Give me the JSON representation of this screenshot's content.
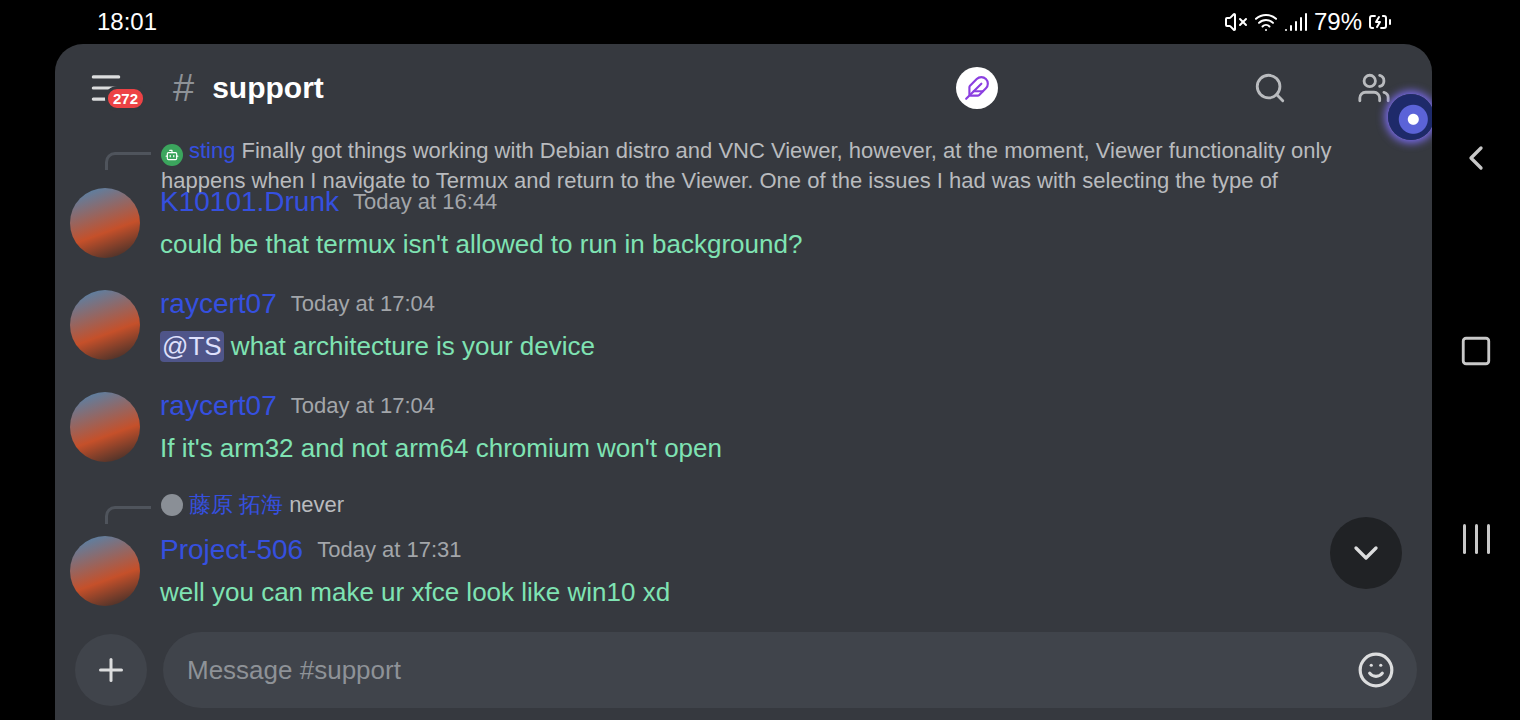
{
  "status_bar": {
    "time": "18:01",
    "battery": "79%"
  },
  "header": {
    "menu_badge": "272",
    "hash": "#",
    "channel": "support"
  },
  "messages": [
    {
      "author": "K10101.Drunk",
      "timestamp": "Today at 16:44",
      "reply": {
        "author": "sting",
        "text": "Finally got things working with Debian distro and VNC Viewer, however, at the moment, Viewer functionality only happens when I navigate to Termux and return to the Viewer.  One of the issues I had was with selecting the type of"
      },
      "parts": [
        {
          "text": "could be that termux isn't allowed to run in background?",
          "mention": false
        }
      ]
    },
    {
      "author": "raycert07",
      "timestamp": "Today at 17:04",
      "reply": null,
      "parts": [
        {
          "text": "@TS",
          "mention": true
        },
        {
          "text": " what architecture is your device",
          "mention": false
        }
      ]
    },
    {
      "author": "raycert07",
      "timestamp": "Today at 17:04",
      "reply": null,
      "parts": [
        {
          "text": "If it's arm32 and not arm64 chromium won't open",
          "mention": false
        }
      ]
    },
    {
      "author": "Project-506",
      "timestamp": "Today at 17:31",
      "reply": {
        "author": "藤原 拓海",
        "text": "never"
      },
      "parts": [
        {
          "text": "well you can make ur xfce look like win10 xd",
          "mention": false
        }
      ]
    }
  ],
  "composer": {
    "placeholder": "Message #support"
  }
}
